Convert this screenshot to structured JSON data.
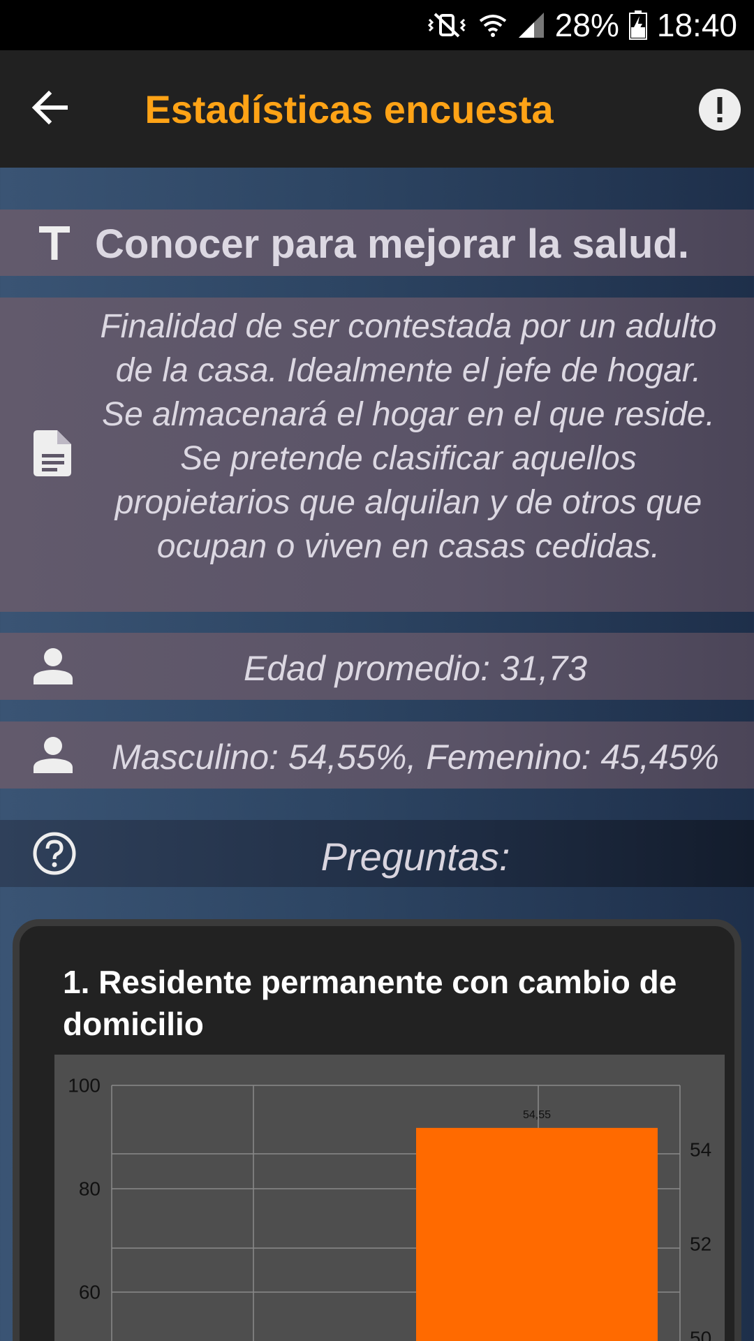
{
  "status_bar": {
    "battery": "28%",
    "time": "18:40"
  },
  "app_bar": {
    "title": "Estadísticas encuesta",
    "back_icon": "arrow-back-icon",
    "info_icon": "alert-circle-icon"
  },
  "survey": {
    "title": "Conocer para mejorar la salud.",
    "title_icon": "text-format-icon",
    "description": "Finalidad de ser contestada por un adulto de la casa. Idealmente el jefe de hogar. Se almacenará el hogar en el que reside. Se pretende clasificar aquellos propietarios que alquilan y de otros que ocupan o viven en casas cedidas.",
    "description_icon": "document-icon",
    "age": "Edad promedio: 31,73",
    "age_icon": "person-icon",
    "gender": "Masculino: 54,55%, Femenino: 45,45%",
    "gender_icon": "person-icon"
  },
  "questions_header": {
    "label": "Preguntas:",
    "icon": "help-circle-icon"
  },
  "question_card": {
    "title": "1. Residente permanente con cambio de domicilio"
  },
  "chart_data": {
    "type": "bar",
    "left_axis": {
      "ticks": [
        "100",
        "80",
        "60"
      ]
    },
    "right_axis": {
      "ticks": [
        "54",
        "52",
        "50"
      ]
    },
    "bars": [
      {
        "value": 54.55,
        "label": "54,55",
        "color": "#ff6a00"
      }
    ],
    "grid": true
  },
  "colors": {
    "accent": "#ffa316",
    "bar": "#ff6a00"
  }
}
